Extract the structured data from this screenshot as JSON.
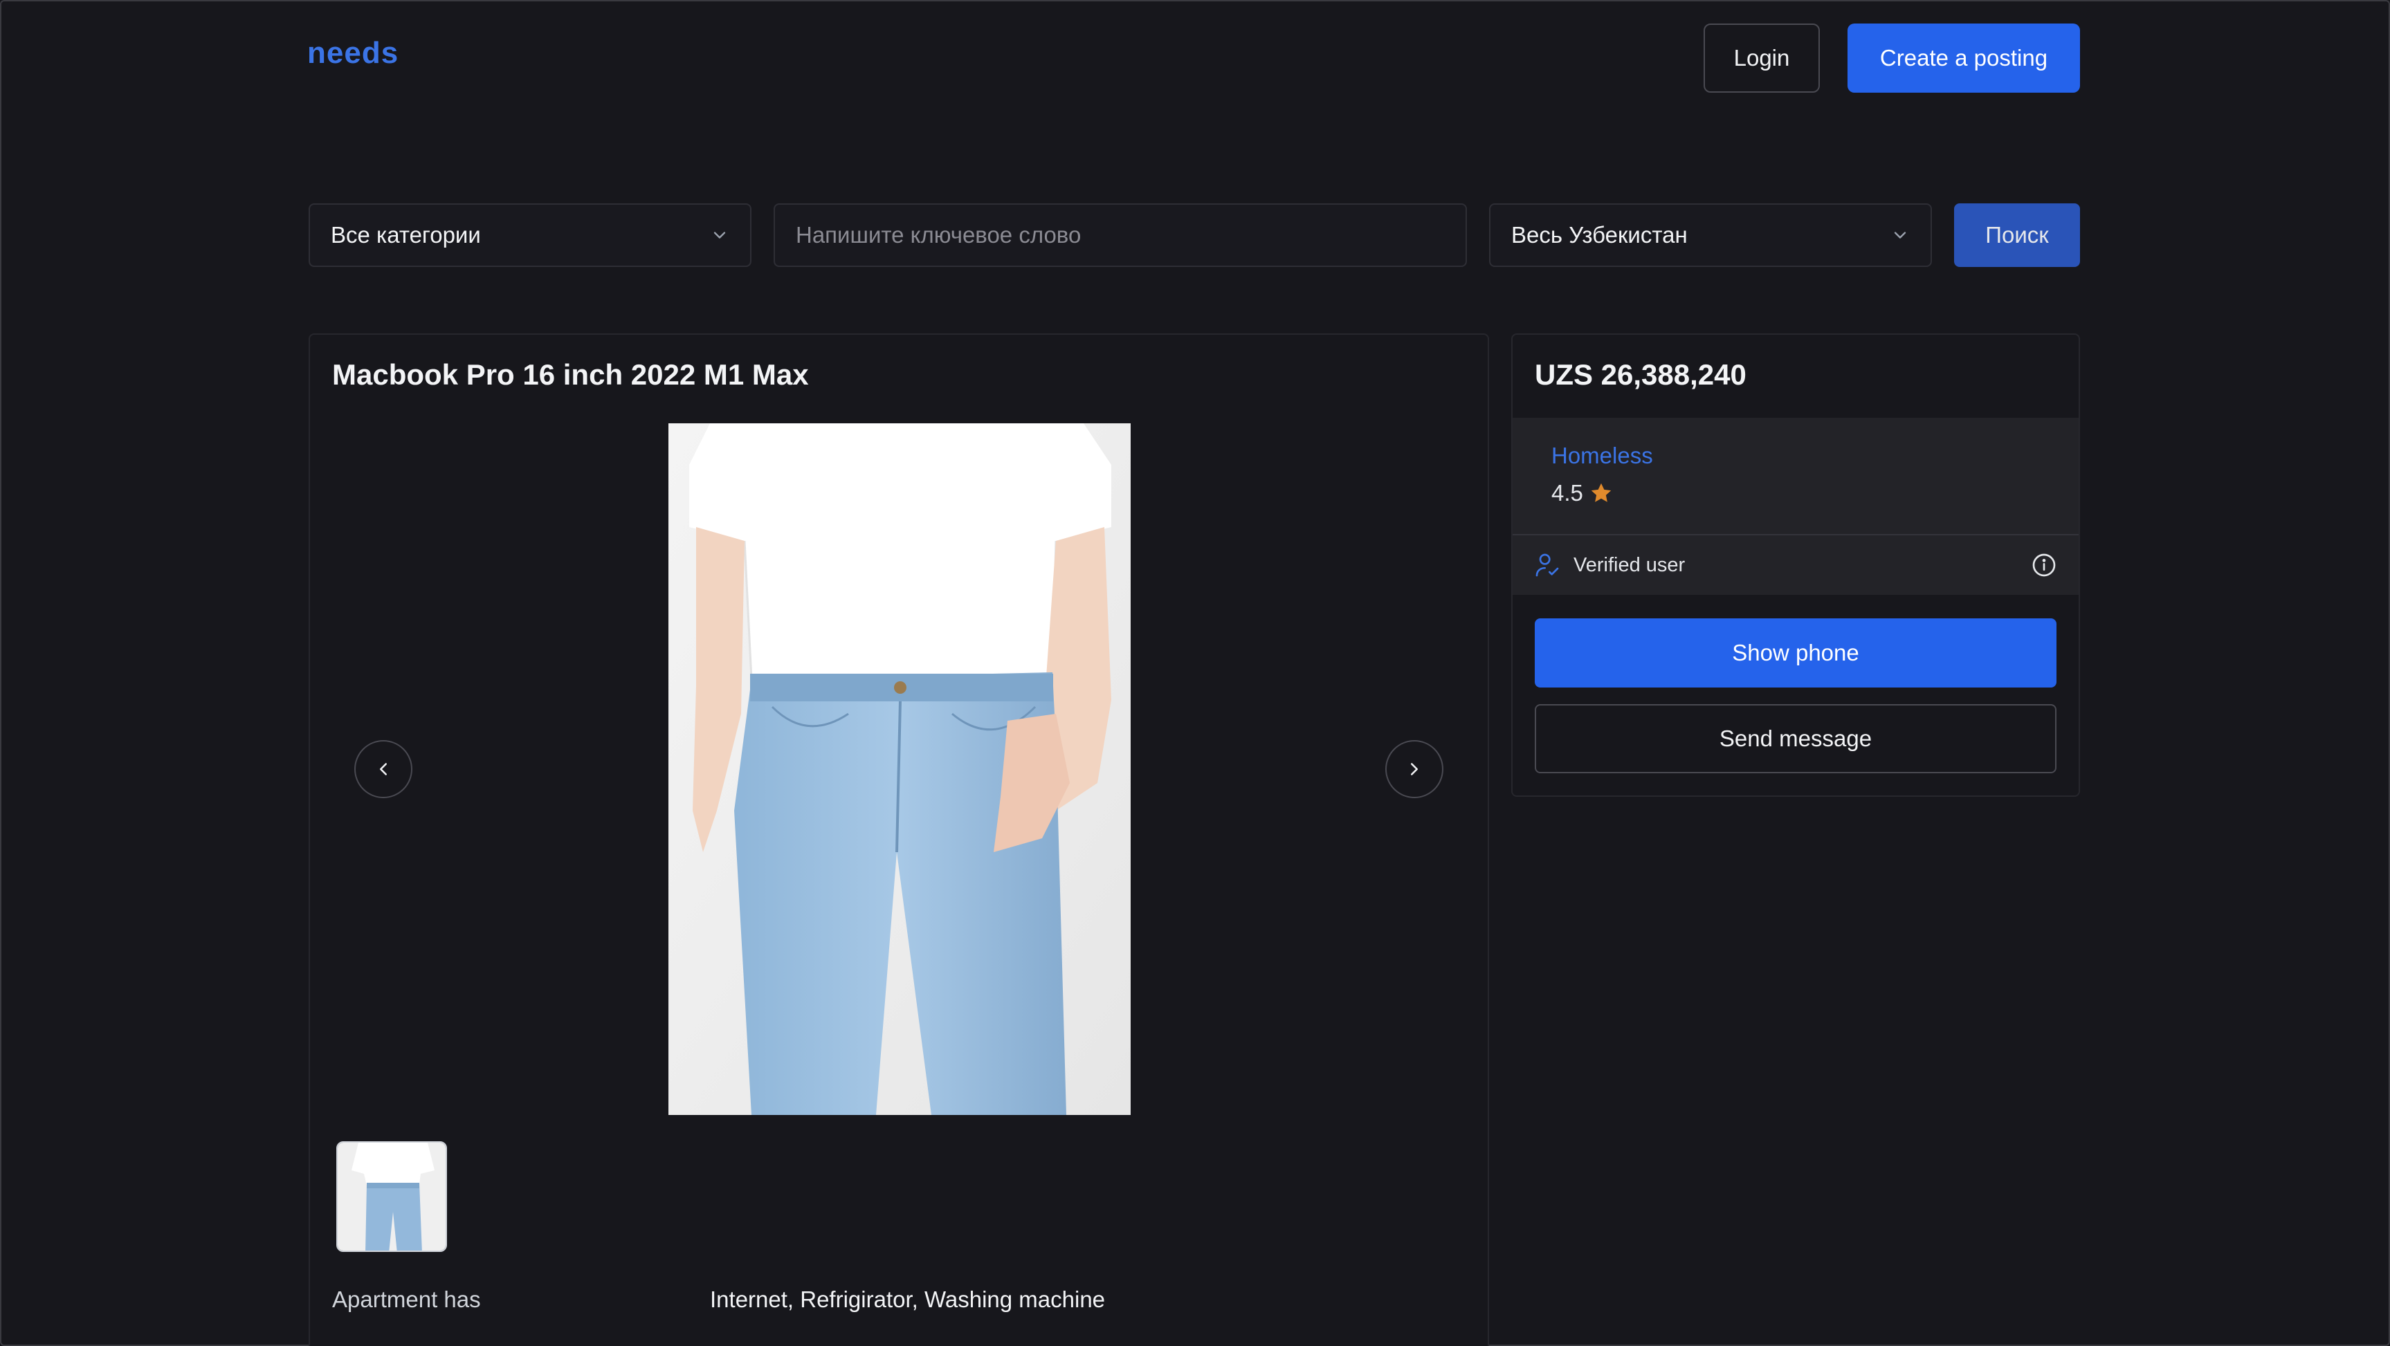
{
  "header": {
    "logo": "needs",
    "login_label": "Login",
    "create_label": "Create a posting"
  },
  "search": {
    "category_value": "Все категории",
    "keyword_placeholder": "Напишите ключевое слово",
    "region_value": "Весь Узбекистан",
    "search_label": "Поиск"
  },
  "listing": {
    "title": "Macbook Pro 16 inch 2022 M1 Max",
    "photo_count": 1,
    "specs": [
      {
        "label": "Apartment has",
        "value": "Internet, Refrigirator, Washing machine"
      }
    ]
  },
  "sidebar": {
    "price": "UZS 26,388,240",
    "seller_name": "Homeless",
    "rating": "4.5",
    "verified_label": "Verified user",
    "show_phone_label": "Show phone",
    "send_message_label": "Send message"
  },
  "colors": {
    "background": "#17171c",
    "accent": "#2563eb",
    "link": "#3b74e6",
    "star": "#e08a2c"
  },
  "icons": [
    "chevron-down-icon",
    "chevron-left-icon",
    "chevron-right-icon",
    "user-check-icon",
    "info-icon",
    "star-icon"
  ]
}
